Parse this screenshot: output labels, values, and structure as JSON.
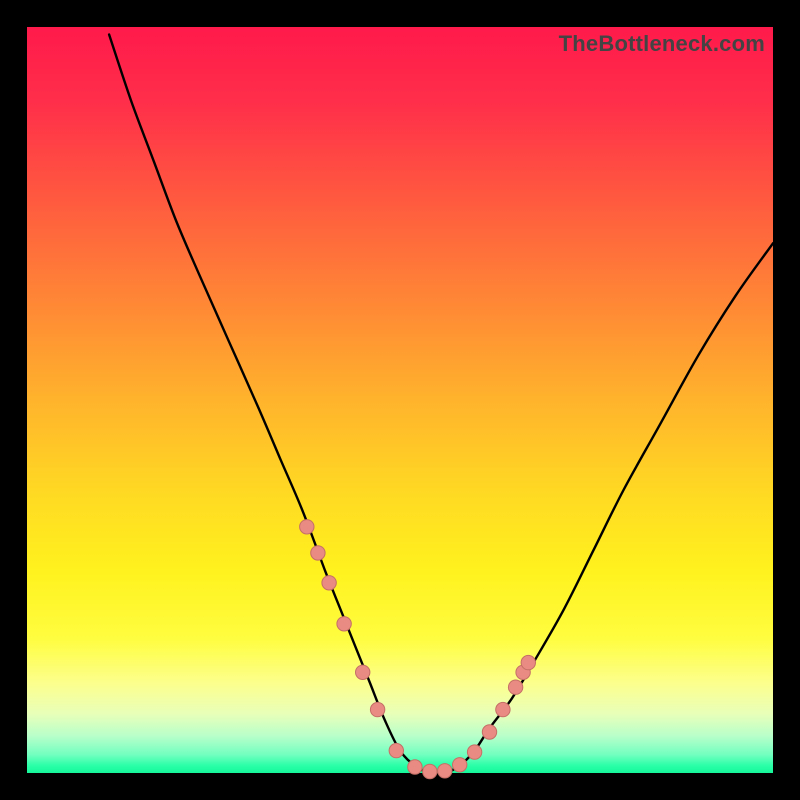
{
  "watermark": "TheBottleneck.com",
  "colors": {
    "frame": "#000000",
    "curve": "#000000",
    "marker_fill": "#e98b82",
    "marker_stroke": "#c46f66"
  },
  "chart_data": {
    "type": "line",
    "title": "",
    "xlabel": "",
    "ylabel": "",
    "xlim": [
      0,
      100
    ],
    "ylim": [
      0,
      100
    ],
    "grid": false,
    "legend": "none",
    "series": [
      {
        "name": "bottleneck-curve",
        "x": [
          11,
          14,
          17,
          20,
          23,
          27,
          31,
          34,
          37,
          40,
          42,
          44,
          46,
          48,
          50,
          52,
          54,
          56,
          58,
          60,
          62,
          65,
          68,
          72,
          76,
          80,
          85,
          90,
          95,
          100
        ],
        "y": [
          99,
          90,
          82,
          74,
          67,
          58,
          49,
          42,
          35,
          27,
          22,
          17,
          12,
          7,
          3,
          1,
          0,
          0,
          1,
          3,
          6,
          10,
          15,
          22,
          30,
          38,
          47,
          56,
          64,
          71
        ]
      }
    ],
    "markers": {
      "name": "highlight-points",
      "x": [
        37.5,
        39.0,
        40.5,
        42.5,
        45.0,
        47.0,
        49.5,
        52.0,
        54.0,
        56.0,
        58.0,
        60.0,
        62.0,
        63.8,
        65.5,
        66.5,
        67.2
      ],
      "y": [
        33.0,
        29.5,
        25.5,
        20.0,
        13.5,
        8.5,
        3.0,
        0.8,
        0.2,
        0.3,
        1.1,
        2.8,
        5.5,
        8.5,
        11.5,
        13.5,
        14.8
      ]
    }
  }
}
